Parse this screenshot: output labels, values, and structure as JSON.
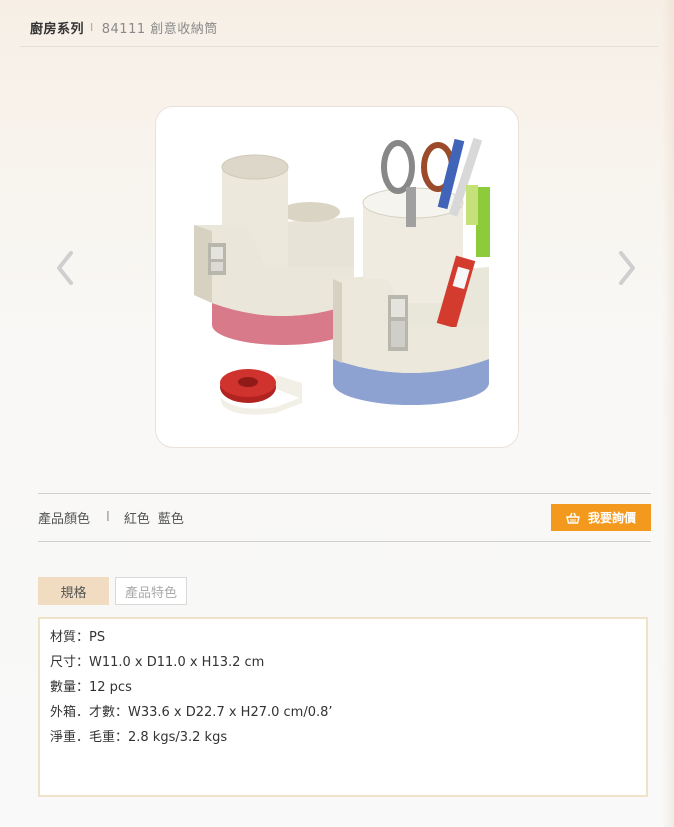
{
  "breadcrumb": {
    "category": "廚房系列",
    "separator": "I",
    "product": "84111 創意收納筒"
  },
  "gallery": {
    "prev_icon": "chevron-left-icon",
    "next_icon": "chevron-right-icon",
    "image_alt": "84111 創意收納筒"
  },
  "colors": {
    "label": "產品顏色",
    "separator": "I",
    "options": [
      "紅色",
      "藍色"
    ],
    "inquiry_button": "我要詢價",
    "inquiry_icon": "basket-icon",
    "accent": "#f39a1e"
  },
  "tabs": [
    {
      "label": "規格",
      "active": true
    },
    {
      "label": "產品特色",
      "active": false
    }
  ],
  "specs": [
    "材質：PS",
    "尺寸：W11.0 x D11.0 x H13.2 cm",
    "數量：12 pcs",
    "外箱．才數：W33.6 x D22.7 x H27.0 cm/0.8’",
    "淨重．毛重：2.8 kgs/3.2 kgs"
  ]
}
